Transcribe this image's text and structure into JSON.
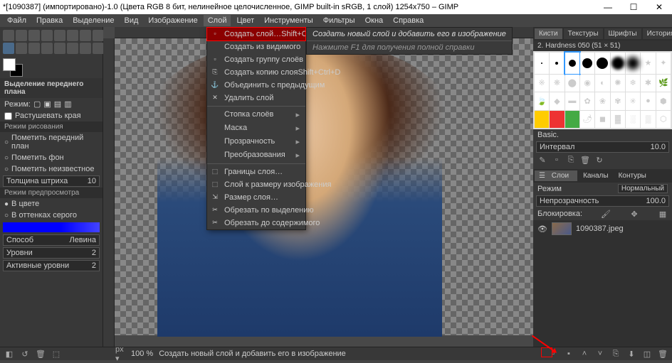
{
  "title": "*[1090387] (импортировано)-1.0 (Цвета RGB 8 бит, нелинейное целочисленное, GIMP built-in sRGB, 1 слой) 1254x750 – GIMP",
  "menubar": [
    "Файл",
    "Правка",
    "Выделение",
    "Вид",
    "Изображение",
    "Слой",
    "Цвет",
    "Инструменты",
    "Фильтры",
    "Окна",
    "Справка"
  ],
  "active_menu_index": 5,
  "dropdown": {
    "items": [
      {
        "icon": "▫",
        "label": "Создать слой…",
        "shortcut": "Shift+Ctrl+N",
        "hl": true
      },
      {
        "icon": "",
        "label": "Создать из видимого",
        "shortcut": ""
      },
      {
        "icon": "▫",
        "label": "Создать группу слоёв",
        "shortcut": ""
      },
      {
        "icon": "⎘",
        "label": "Создать копию слоя",
        "shortcut": "Shift+Ctrl+D"
      },
      {
        "icon": "⚓",
        "label": "Объединить с предыдущим",
        "shortcut": "",
        "dis": true
      },
      {
        "icon": "✕",
        "label": "Удалить слой",
        "shortcut": ""
      },
      {
        "sep": true
      },
      {
        "label": "Стопка слоёв",
        "sub": true
      },
      {
        "label": "Маска",
        "sub": true
      },
      {
        "label": "Прозрачность",
        "sub": true
      },
      {
        "label": "Преобразования",
        "sub": true
      },
      {
        "sep": true
      },
      {
        "icon": "⬚",
        "label": "Границы слоя…",
        "shortcut": ""
      },
      {
        "icon": "⬚",
        "label": "Слой к размеру изображения",
        "shortcut": ""
      },
      {
        "icon": "⇲",
        "label": "Размер слоя…",
        "shortcut": ""
      },
      {
        "icon": "✂",
        "label": "Обрезать по выделению",
        "shortcut": ""
      },
      {
        "icon": "✂",
        "label": "Обрезать до содержимого",
        "shortcut": ""
      }
    ]
  },
  "tooltip": {
    "line1": "Создать новый слой и добавить его в изображение",
    "line2": "Нажмите F1 для получения полной справки"
  },
  "leftpanel": {
    "tooloptions_title": "Выделение переднего плана",
    "mode_label": "Режим:",
    "feather": "Растушевать края",
    "drawmode_title": "Режим рисования",
    "draw_fg": "Пометить передний план",
    "draw_bg": "Пометить фон",
    "draw_unknown": "Пометить неизвестное",
    "stroke_width": "Толщина штриха",
    "stroke_val": "10",
    "preview_title": "Режим предпросмотра",
    "color_mode": "В цвете",
    "gray_mode": "В оттенках серого",
    "engine_label": "Способ",
    "engine_val": "Левина",
    "levels": "Уровни",
    "active_levels": "Активные уровни"
  },
  "rightpanel": {
    "tabs": [
      "Кисти",
      "Текстуры",
      "Шрифты",
      "История"
    ],
    "brush_name": "2. Hardness 050 (51 × 51)",
    "basic": "Basic.",
    "interval_label": "Интервал",
    "interval_val": "10.0",
    "layer_tabs": [
      "Слои",
      "Каналы",
      "Контуры"
    ],
    "mode_label": "Режим",
    "mode_val": "Нормальный",
    "opacity_label": "Непрозрачность",
    "opacity_val": "100.0",
    "lock_label": "Блокировка:",
    "layer_name": "1090387.jpeg"
  },
  "statusbar": {
    "zoom": "100 %",
    "msg": "Создать новый слой и добавить его в изображение"
  }
}
